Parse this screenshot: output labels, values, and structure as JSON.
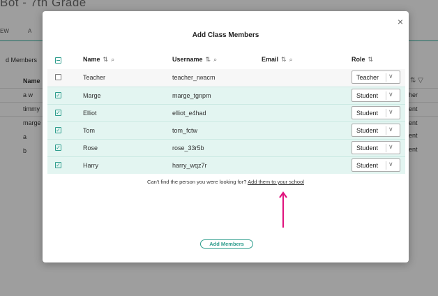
{
  "background": {
    "title": "Bot - 7th Grade",
    "tabs": [
      "EW",
      "A"
    ],
    "members_label": "d Members",
    "name_header": "Name",
    "rows": [
      "a w",
      "timmy",
      "marge",
      "a",
      "b"
    ],
    "right_col_header": "⇅ ▽",
    "right_col": [
      "her",
      "ent",
      "ent",
      "ent",
      "ent"
    ]
  },
  "modal": {
    "title": "Add Class Members",
    "close_label": "×",
    "columns": {
      "name": "Name",
      "username": "Username",
      "email": "Email",
      "role": "Role"
    },
    "sort_icon": "⇅",
    "search_icon": "⌕",
    "rows": [
      {
        "name": "Teacher",
        "username": "teacher_rwacm",
        "email": "",
        "role": "Teacher",
        "checked": false
      },
      {
        "name": "Marge",
        "username": "marge_tgnpm",
        "email": "",
        "role": "Student",
        "checked": true
      },
      {
        "name": "Elliot",
        "username": "elliot_e4had",
        "email": "",
        "role": "Student",
        "checked": true
      },
      {
        "name": "Tom",
        "username": "tom_fctw",
        "email": "",
        "role": "Student",
        "checked": true
      },
      {
        "name": "Rose",
        "username": "rose_33r5b",
        "email": "",
        "role": "Student",
        "checked": true
      },
      {
        "name": "Harry",
        "username": "harry_wqz7r",
        "email": "",
        "role": "Student",
        "checked": true
      }
    ],
    "help_text": "Can't find the person you were looking for?",
    "help_link": "Add them to your school",
    "add_button": "Add Members",
    "accent_color": "#2e9d8d",
    "arrow_color": "#e0157e"
  }
}
